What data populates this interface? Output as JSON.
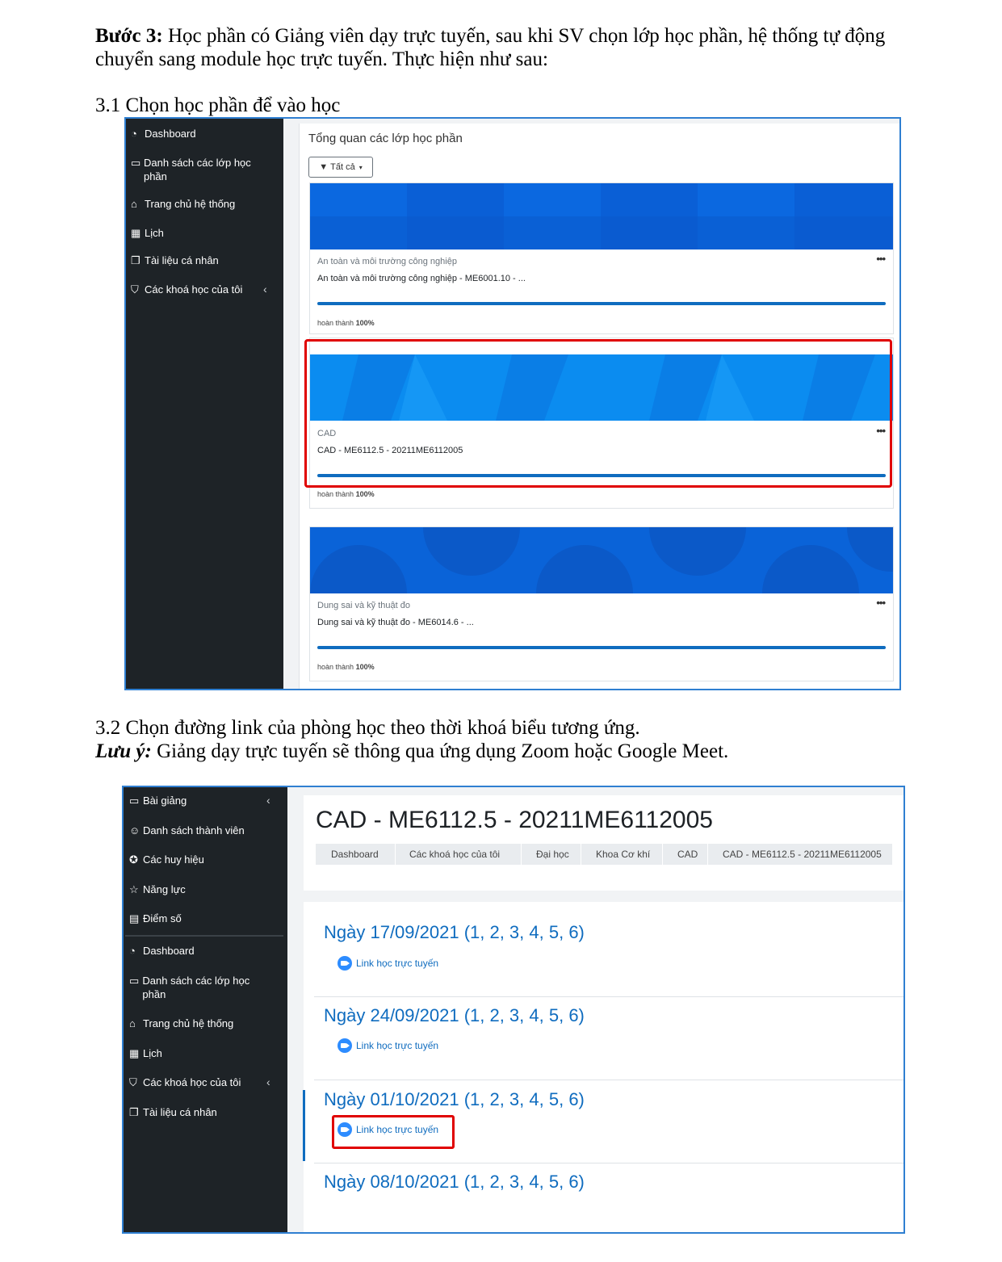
{
  "doc": {
    "step_label": "Bước 3:",
    "step_text": " Học phần có Giảng viên dạy trực tuyến, sau khi SV chọn lớp học phần, hệ thống tự động chuyển sang module học trực tuyến. Thực hiện như sau:",
    "section_1": "3.1 Chọn học phần để vào học",
    "section_2": "3.2 Chọn đường link của phòng học theo thời khoá biểu tương ứng.",
    "note_label": "Lưu ý:",
    "note_text": " Giảng dạy trực tuyến sẽ thông qua ứng dụng Zoom hoặc Google Meet."
  },
  "shot1": {
    "sidebar": [
      {
        "icon": "dashboard-icon",
        "label": "Dashboard"
      },
      {
        "icon": "folder-icon",
        "label": "Danh sách các lớp học phần"
      },
      {
        "icon": "home-icon",
        "label": "Trang chủ hệ thống"
      },
      {
        "icon": "calendar-icon",
        "label": "Lịch"
      },
      {
        "icon": "file-icon",
        "label": "Tài liệu cá nhân"
      },
      {
        "icon": "graduation-cap-icon",
        "label": "Các khoá học của tôi"
      }
    ],
    "heading": "Tổng quan các lớp học phần",
    "filter_label": "Tất cả",
    "cards": [
      {
        "category": "An toàn và môi trường công nghiệp",
        "name": "An toàn và môi trường công nghiệp - ME6001.10 - ...",
        "progress_label": "hoàn thành",
        "progress": "100%",
        "progress_value": 100,
        "banner_color": "#0a5fd6"
      },
      {
        "category": "CAD",
        "name": "CAD - ME6112.5 - 20211ME6112005",
        "progress_label": "hoàn thành",
        "progress": "100%",
        "progress_value": 100,
        "banner_color": "#0b8cf0"
      },
      {
        "category": "Dung sai và kỹ thuật đo",
        "name": "Dung sai và kỹ thuật đo - ME6014.6 - ...",
        "progress_label": "hoàn thành",
        "progress": "100%",
        "progress_value": 100,
        "banner_color": "#0a63d8"
      }
    ]
  },
  "shot2": {
    "sidebar_top": [
      {
        "icon": "folder-icon",
        "label": "Bài giảng"
      },
      {
        "icon": "users-icon",
        "label": "Danh sách thành viên"
      },
      {
        "icon": "badge-icon",
        "label": "Các huy hiệu"
      },
      {
        "icon": "star-icon",
        "label": "Năng lực"
      },
      {
        "icon": "gradebook-icon",
        "label": "Điểm số"
      }
    ],
    "sidebar_bottom": [
      {
        "icon": "dashboard-icon",
        "label": "Dashboard"
      },
      {
        "icon": "folder-icon",
        "label": "Danh sách các lớp học phần"
      },
      {
        "icon": "home-icon",
        "label": "Trang chủ hệ thống"
      },
      {
        "icon": "calendar-icon",
        "label": "Lịch"
      },
      {
        "icon": "graduation-cap-icon",
        "label": "Các khoá học của tôi"
      },
      {
        "icon": "file-icon",
        "label": "Tài liệu cá nhân"
      }
    ],
    "course_title": "CAD - ME6112.5 - 20211ME6112005",
    "breadcrumb": [
      "Dashboard",
      "Các khoá học của tôi",
      "Đại học",
      "Khoa Cơ khí",
      "CAD",
      "CAD - ME6112.5 - 20211ME6112005"
    ],
    "sessions": [
      {
        "date": "Ngày 17/09/2021 (1, 2, 3, 4, 5, 6)",
        "link": "Link học trực tuyến"
      },
      {
        "date": "Ngày 24/09/2021 (1, 2, 3, 4, 5, 6)",
        "link": "Link học trực tuyến"
      },
      {
        "date": "Ngày 01/10/2021 (1, 2, 3, 4, 5, 6)",
        "link": "Link học trực tuyến"
      },
      {
        "date": "Ngày 08/10/2021 (1, 2, 3, 4, 5, 6)",
        "link": ""
      }
    ]
  },
  "colors": {
    "highlight": "#e00000",
    "sidebar": "#1e2327",
    "accent": "#0f6cbf",
    "frame": "#2f7fd1"
  }
}
